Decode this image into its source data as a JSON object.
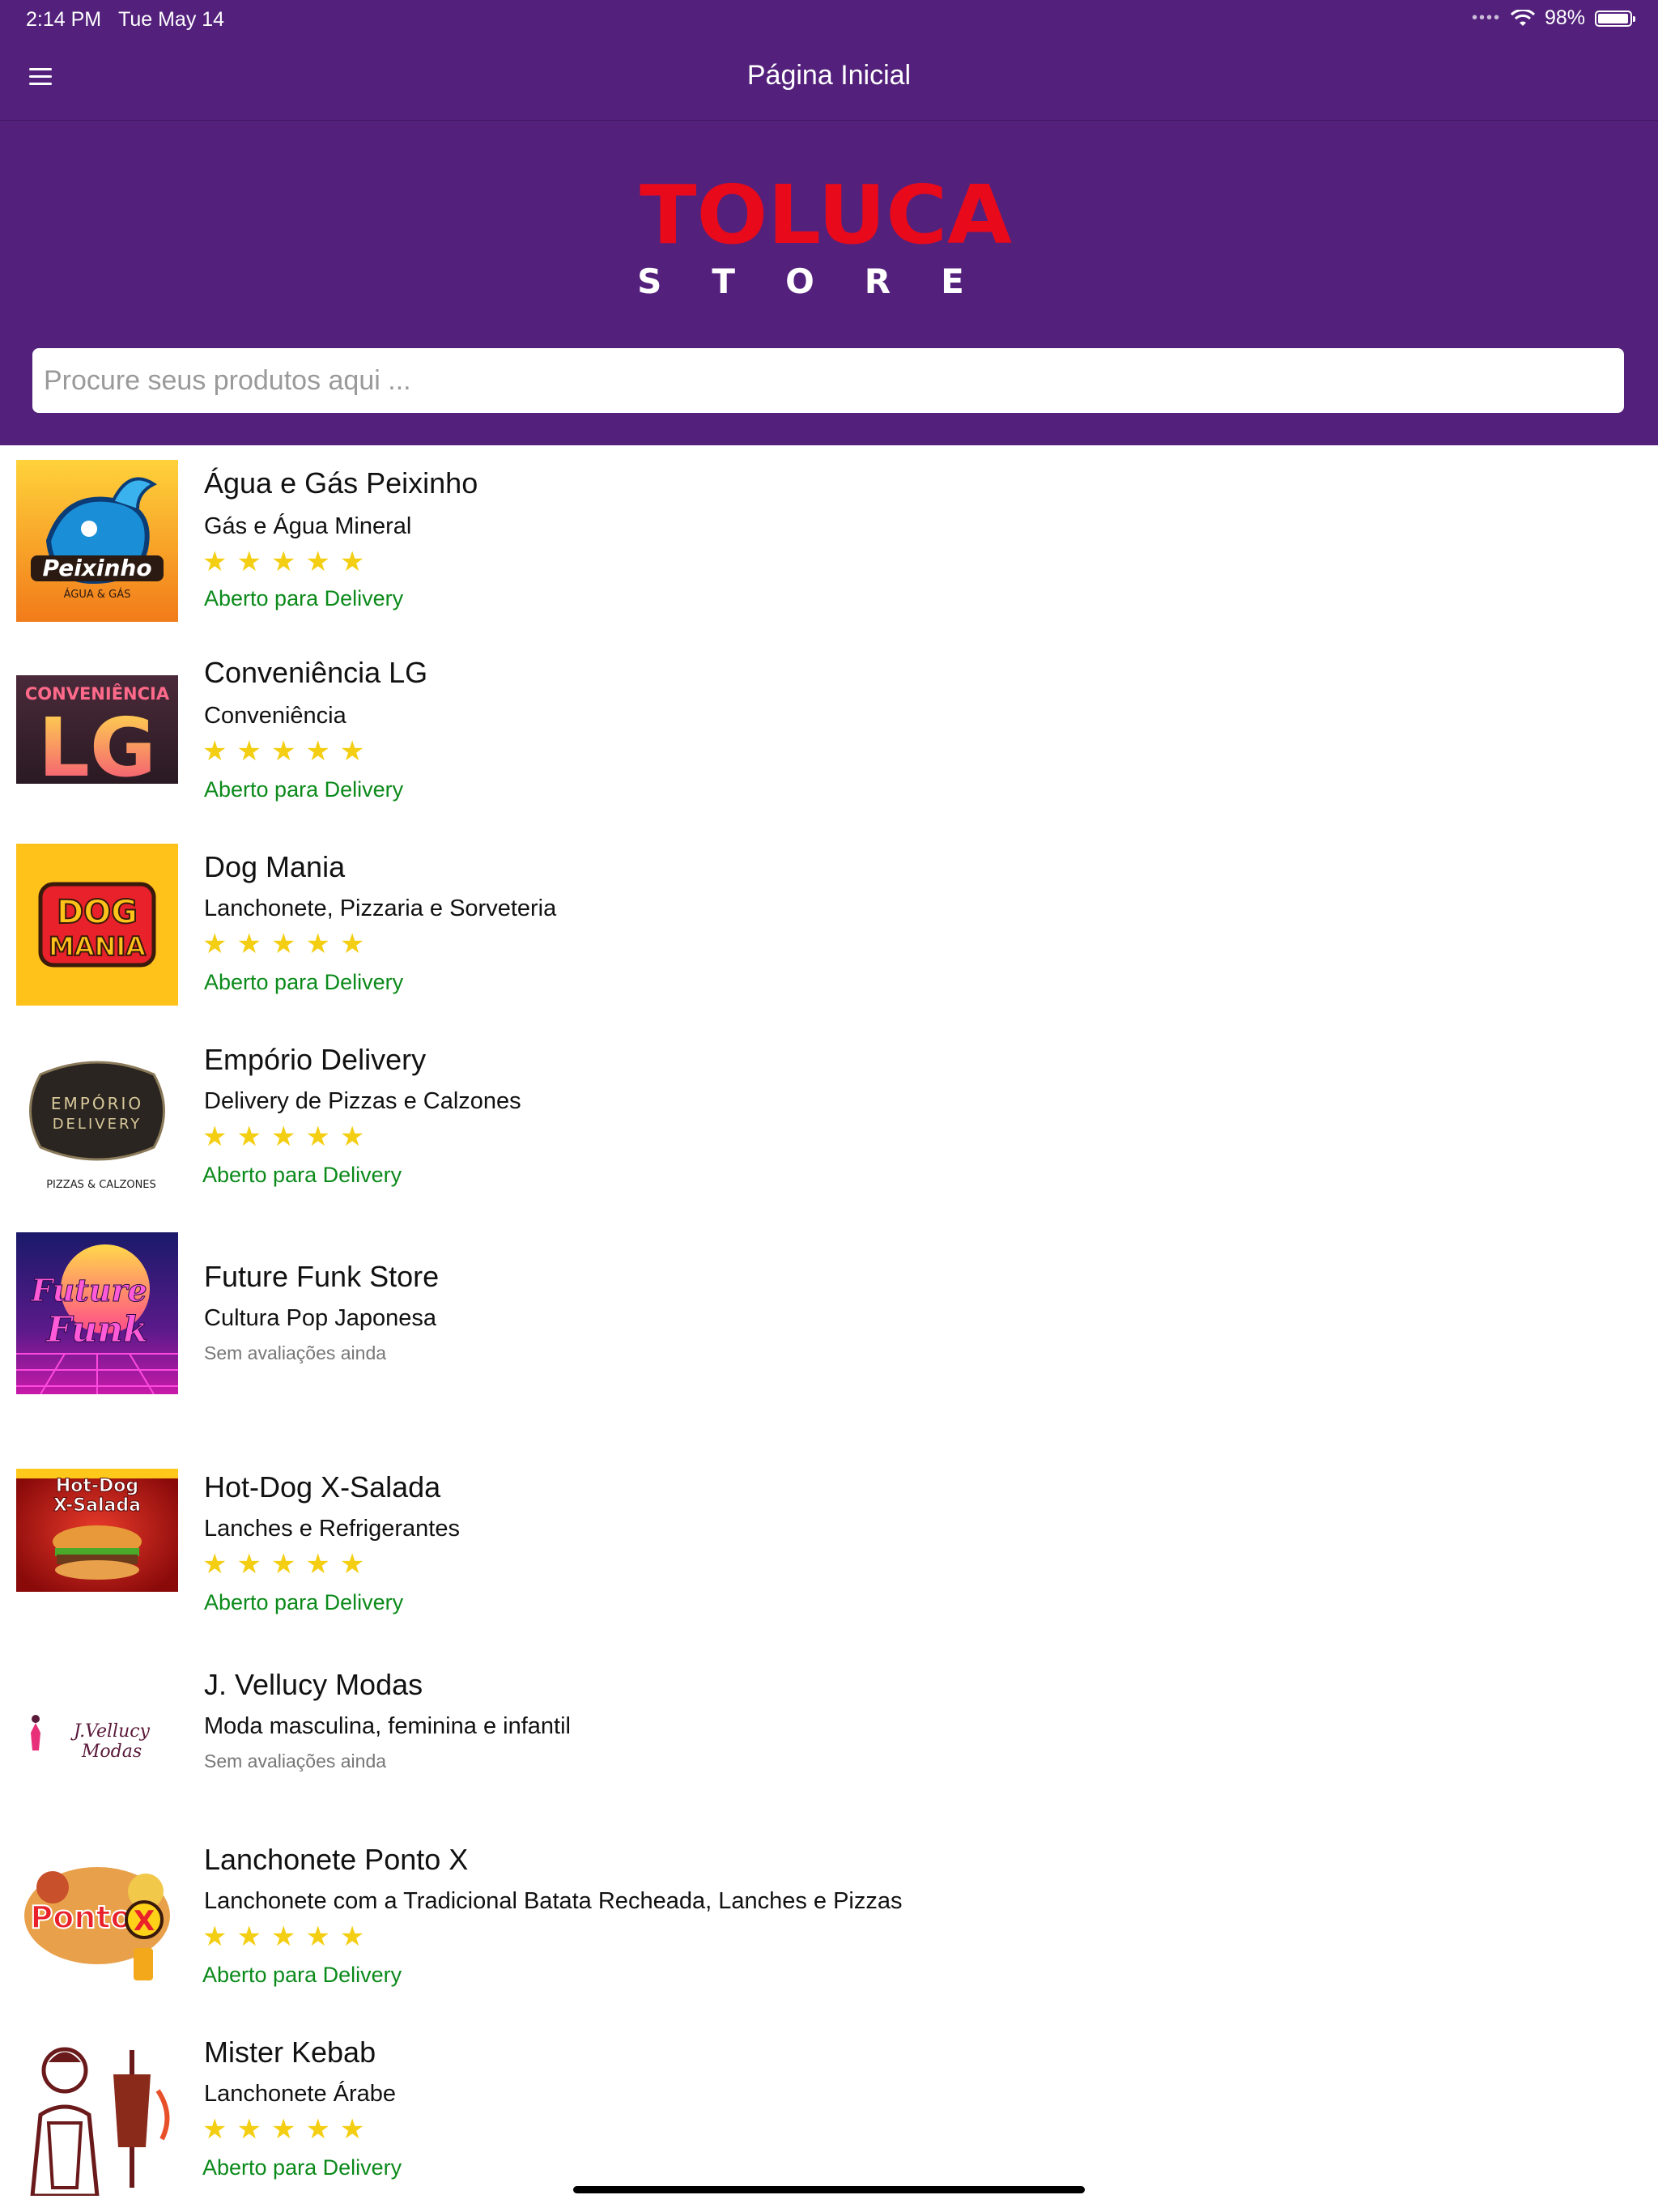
{
  "status_bar": {
    "time": "2:14 PM",
    "date": "Tue May 14",
    "battery": "98%",
    "battery_level": 0.98
  },
  "nav": {
    "title": "Página Inicial"
  },
  "logo": {
    "line1": "TOLUCA",
    "line2": "STORE"
  },
  "search": {
    "placeholder": "Procure seus produtos aqui ...",
    "value": ""
  },
  "colors": {
    "header": "#53217c",
    "open_status": "#0b8a1a",
    "star": "#f3ce13",
    "logo_red": "#e8091b"
  },
  "stores": [
    {
      "name": "Água e Gás Peixinho",
      "category": "Gás e Água Mineral",
      "rating": "★★★★★",
      "status": "Aberto para Delivery",
      "logo_text": "Peixinho"
    },
    {
      "name": "Conveniência LG",
      "category": "Conveniência",
      "rating": "★★★★★",
      "status": "Aberto para Delivery",
      "logo_text": "CONVENIÊNCIA LG"
    },
    {
      "name": "Dog Mania",
      "category": "Lanchonete, Pizzaria e Sorveteria",
      "rating": "★★★★★",
      "status": "Aberto para Delivery",
      "logo_text": "DOG MANIA"
    },
    {
      "name": "Empório Delivery",
      "category": "Delivery de Pizzas e Calzones",
      "rating": "★★★★★",
      "status": "Aberto para Delivery",
      "logo_text": "EMPÓRIO DELIVERY PIZZAS & CALZONES"
    },
    {
      "name": "Future Funk Store",
      "category": "Cultura Pop Japonesa",
      "rating": "",
      "status": "Sem avaliações ainda",
      "logo_text": "Future Funk"
    },
    {
      "name": "Hot-Dog X-Salada",
      "category": "Lanches e Refrigerantes",
      "rating": "★★★★★",
      "status": "Aberto para Delivery",
      "logo_text": "Hot-Dog X-Salada"
    },
    {
      "name": "J. Vellucy Modas",
      "category": "Moda masculina, feminina e infantil",
      "rating": "",
      "status": "Sem avaliações ainda",
      "logo_text": "J.Vellucy Modas"
    },
    {
      "name": "Lanchonete Ponto X",
      "category": "Lanchonete com a Tradicional Batata Recheada, Lanches e Pizzas",
      "rating": "★★★★★",
      "status": "Aberto para Delivery",
      "logo_text": "Ponto X"
    },
    {
      "name": "Mister Kebab",
      "category": "Lanchonete Árabe",
      "rating": "★★★★★",
      "status": "Aberto para Delivery",
      "logo_text": ""
    }
  ]
}
